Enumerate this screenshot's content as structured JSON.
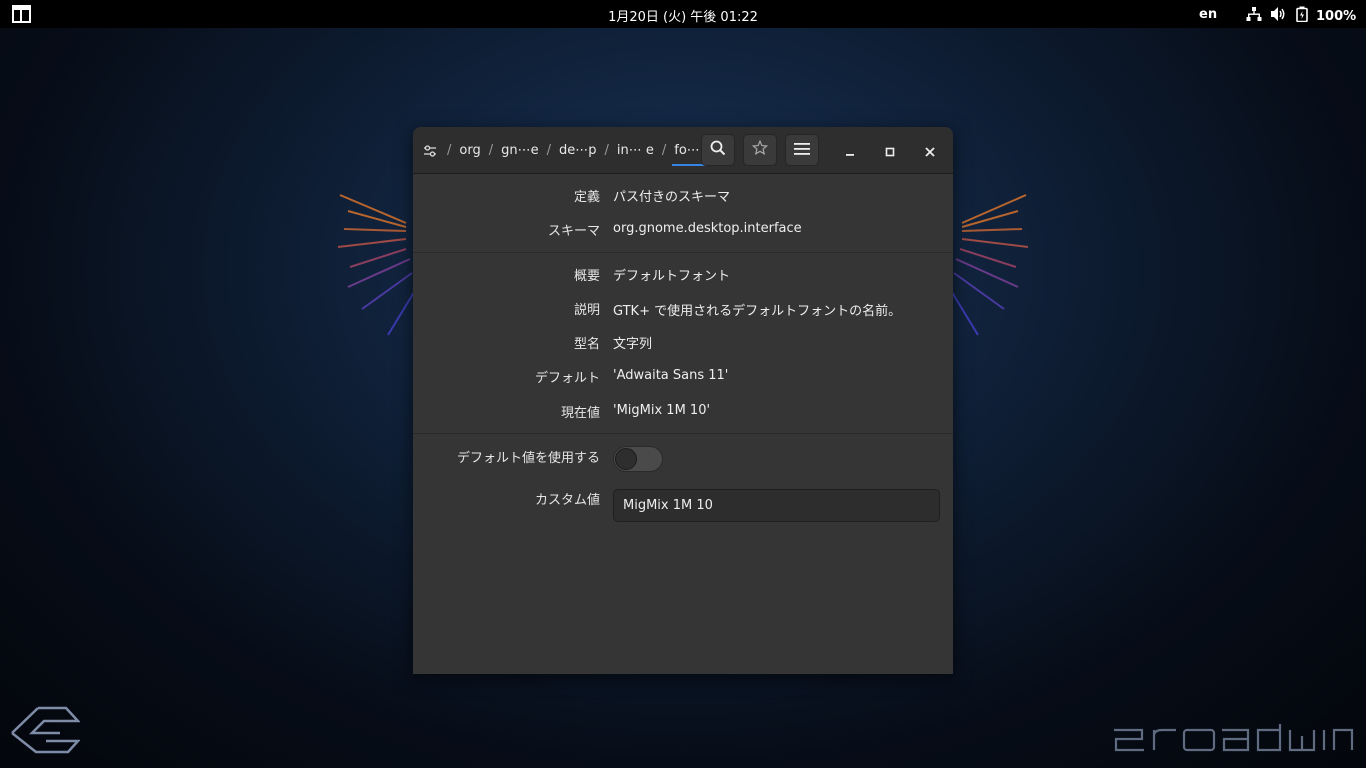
{
  "topbar": {
    "clock": "1月20日 (火) 午後 01:22",
    "language": "en",
    "battery": "100%",
    "icons": [
      "activities-icon",
      "network-icon",
      "volume-icon",
      "battery-icon"
    ]
  },
  "window": {
    "breadcrumbs": [
      "org",
      "gn⋯e",
      "de⋯p",
      "in⋯ e",
      "fo⋯ e"
    ],
    "active_crumb_index": 4,
    "header_icons": [
      "settings-sliders-icon",
      "search-icon",
      "bookmark-star-icon",
      "hamburger-menu-icon",
      "minimize-icon",
      "maximize-icon",
      "close-icon"
    ],
    "fields": {
      "definition_label": "定義",
      "definition_value": "パス付きのスキーマ",
      "schema_label": "スキーマ",
      "schema_value": "org.gnome.desktop.interface",
      "summary_label": "概要",
      "summary_value": "デフォルトフォント",
      "description_label": "説明",
      "description_value": "GTK+ で使用されるデフォルトフォントの名前。",
      "type_label": "型名",
      "type_value": "文字列",
      "default_label": "デフォルト",
      "default_value": "'Adwaita Sans 11'",
      "current_label": "現在値",
      "current_value": "'MigMix 1M 10'"
    },
    "use_default_label": "デフォルト値を使用する",
    "use_default_on": false,
    "custom_value_label": "カスタム値",
    "custom_value": "MigMix 1M 10"
  },
  "desktop": {
    "brand_logo": "broadwing-wordmark",
    "logo_icon": "broadwing-logo-icon"
  },
  "colors": {
    "accent": "#3584e4",
    "window_bg": "#353535",
    "headerbar_bg": "#2e2e2e",
    "topbar_bg": "#000000"
  }
}
